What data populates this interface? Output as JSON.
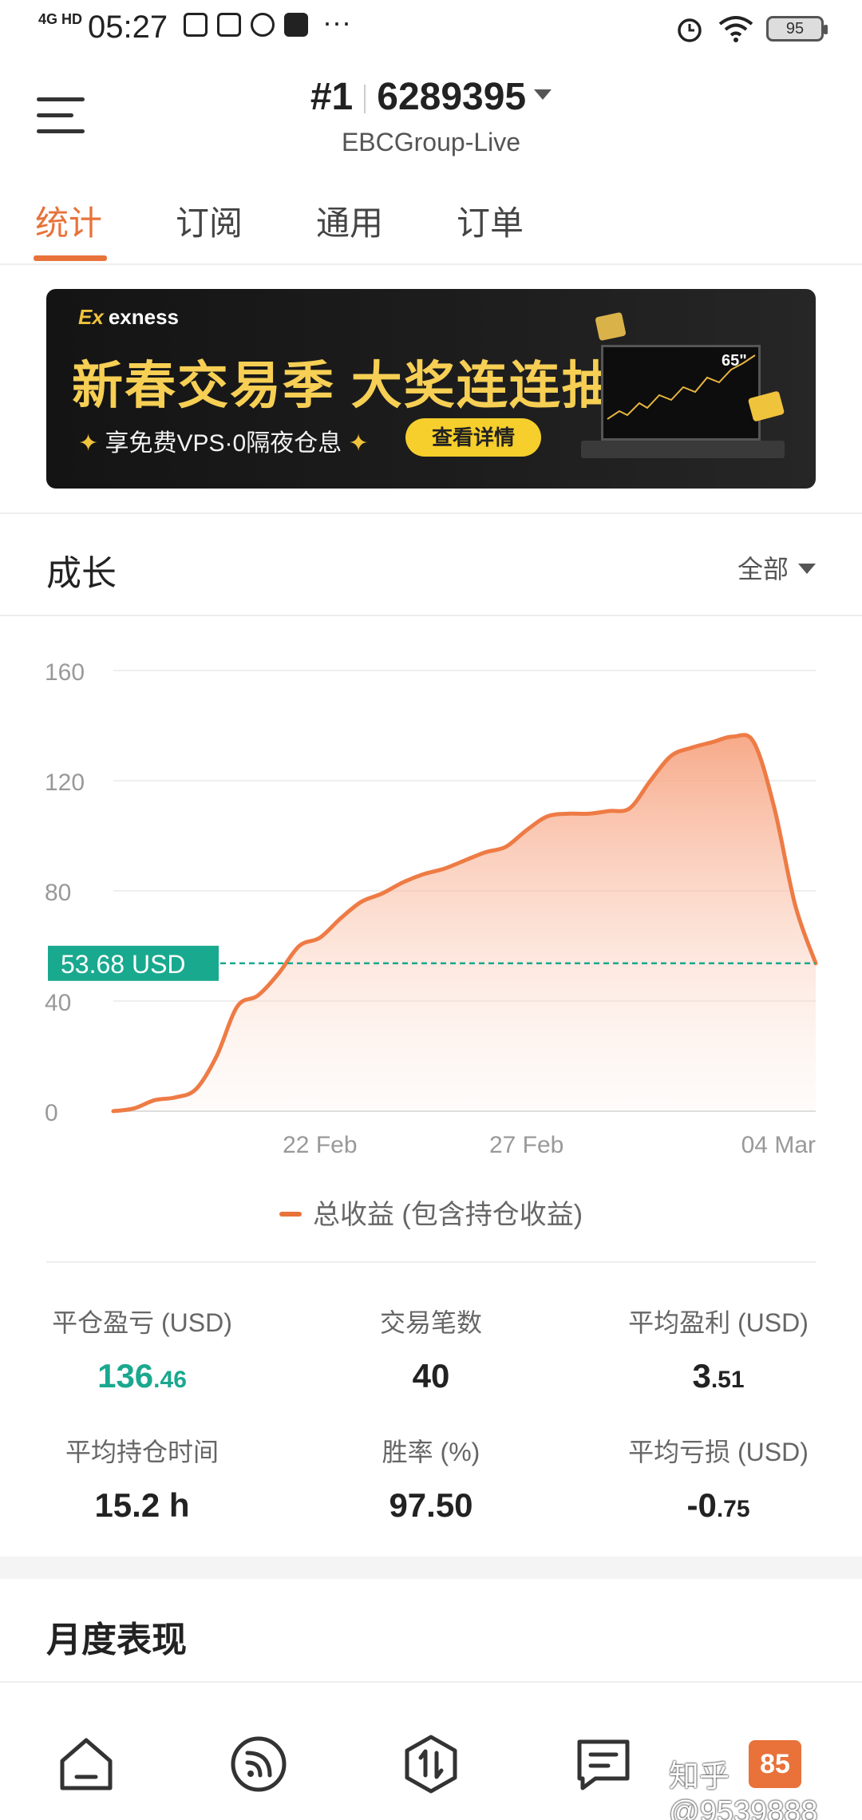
{
  "status_bar": {
    "network": "4G HD",
    "time": "05:27",
    "battery": "95"
  },
  "header": {
    "account_rank": "#1",
    "account_id": "6289395",
    "server": "EBCGroup-Live"
  },
  "tabs": [
    {
      "label": "统计",
      "active": true
    },
    {
      "label": "订阅",
      "active": false
    },
    {
      "label": "通用",
      "active": false
    },
    {
      "label": "订单",
      "active": false
    }
  ],
  "banner": {
    "brand": "exness",
    "title": "新春交易季 大奖连连抽",
    "subtitle": "享免费VPS·0隔夜仓息",
    "button": "查看详情",
    "tv_label": "65\""
  },
  "growth": {
    "title": "成长",
    "filter": "全部",
    "legend": "总收益 (包含持仓收益)",
    "current_marker": "53.68 USD"
  },
  "chart_data": {
    "type": "area",
    "series": [
      {
        "name": "总收益 (包含持仓收益)",
        "values": [
          0,
          1,
          4,
          5,
          8,
          20,
          38,
          42,
          50,
          60,
          63,
          70,
          76,
          79,
          83,
          86,
          88,
          91,
          94,
          96,
          102,
          107,
          108,
          108,
          109,
          110,
          120,
          129,
          132,
          134,
          136,
          134,
          110,
          75,
          53.68
        ]
      }
    ],
    "x_tick_labels": [
      "22 Feb",
      "27 Feb",
      "04 Mar"
    ],
    "x_tick_index": [
      10,
      20,
      34
    ],
    "y_ticks": [
      0,
      40,
      80,
      120,
      160
    ],
    "ylim": [
      0,
      160
    ],
    "reference_line": 53.68,
    "grid": true,
    "colors": {
      "line": "#ee7b45",
      "reference": "#19a98f"
    }
  },
  "stats": [
    {
      "label": "平仓盈亏 (USD)",
      "int": "136",
      "dec": ".46",
      "green": true
    },
    {
      "label": "交易笔数",
      "int": "40",
      "dec": "",
      "green": false
    },
    {
      "label": "平均盈利 (USD)",
      "int": "3",
      "dec": ".51",
      "green": false
    },
    {
      "label": "平均持仓时间",
      "int": "15.2 h",
      "dec": "",
      "green": false
    },
    {
      "label": "胜率 (%)",
      "int": "97.50",
      "dec": "",
      "green": false
    },
    {
      "label": "平均亏损 (USD)",
      "int": "-0",
      "dec": ".75",
      "green": false
    }
  ],
  "monthly": {
    "title": "月度表现"
  },
  "bottom_nav": {
    "badge": "85",
    "watermark": "知乎 @9539888"
  }
}
